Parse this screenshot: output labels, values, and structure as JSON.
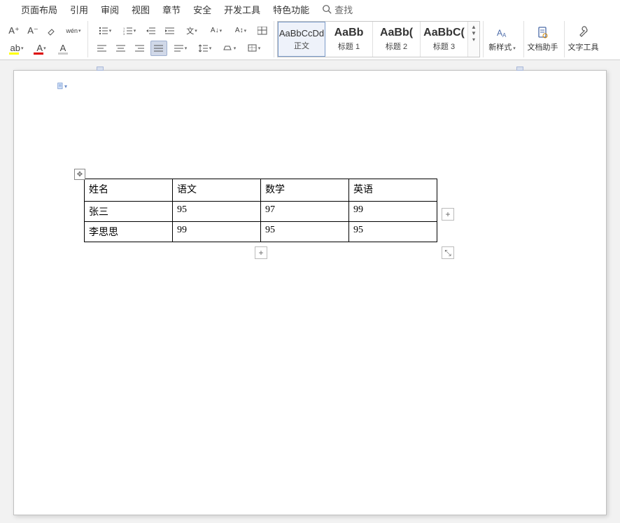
{
  "menu": {
    "items": [
      "页面布局",
      "引用",
      "审阅",
      "视图",
      "章节",
      "安全",
      "开发工具",
      "特色功能"
    ],
    "search_placeholder": "查找"
  },
  "ribbon": {
    "font_tools": {
      "grow": "A⁺",
      "shrink": "A⁻",
      "clear_format": "◇",
      "phonetic": "wén",
      "highlight": "ab",
      "font_color": "A",
      "char_shade": "A"
    },
    "paragraph_tools": {
      "bullets": "•≡",
      "numbering": "1≡",
      "dec_indent": "≡←",
      "inc_indent": "≡→",
      "text_direction": "文",
      "change_case": "Aa",
      "sort": "↕",
      "table": "⊞",
      "align_left": "≡",
      "align_center": "≡",
      "align_right": "≡",
      "justify": "≡",
      "distribute": "≡",
      "line_spacing": "↕≡",
      "shading": "◇",
      "borders": "⊞"
    },
    "styles": [
      {
        "preview": "AaBbCcDd",
        "label": "正文",
        "bold": false,
        "selected": true
      },
      {
        "preview": "AaBb",
        "label": "标题 1",
        "bold": true,
        "selected": false
      },
      {
        "preview": "AaBb(",
        "label": "标题 2",
        "bold": true,
        "selected": false
      },
      {
        "preview": "AaBbC(",
        "label": "标题 3",
        "bold": true,
        "selected": false
      }
    ],
    "new_style": "新样式",
    "doc_assist": "文档助手",
    "text_tools": "文字工具"
  },
  "document": {
    "table": {
      "headers": [
        "姓名",
        "语文",
        "数学",
        "英语"
      ],
      "rows": [
        [
          "张三",
          "95",
          "97",
          "99"
        ],
        [
          "李思思",
          "99",
          "95",
          "95"
        ]
      ]
    },
    "add_col": "+",
    "add_row": "+",
    "resize": "⤡",
    "move": "✥"
  }
}
